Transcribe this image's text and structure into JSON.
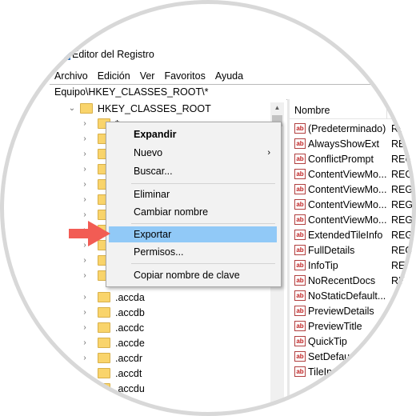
{
  "window": {
    "title": "Editor del Registro"
  },
  "menubar": {
    "items": [
      "Archivo",
      "Edición",
      "Ver",
      "Favoritos",
      "Ayuda"
    ]
  },
  "address": {
    "path": "Equipo\\HKEY_CLASSES_ROOT\\*"
  },
  "tree": {
    "root_label": "HKEY_CLASSES_ROOT",
    "selected_label": "*",
    "items": [
      ".accda",
      ".accdb",
      ".accdc",
      ".accde",
      ".accdr",
      ".accdt",
      ".accdu"
    ]
  },
  "values_pane": {
    "header_name": "Nombre",
    "rows": [
      {
        "name": "(Predeterminado)",
        "type": "RE"
      },
      {
        "name": "AlwaysShowExt",
        "type": "RE"
      },
      {
        "name": "ConflictPrompt",
        "type": "REG"
      },
      {
        "name": "ContentViewMo...",
        "type": "REG"
      },
      {
        "name": "ContentViewMo...",
        "type": "REG"
      },
      {
        "name": "ContentViewMo...",
        "type": "REG"
      },
      {
        "name": "ContentViewMo...",
        "type": "REG"
      },
      {
        "name": "ExtendedTileInfo",
        "type": "REG"
      },
      {
        "name": "FullDetails",
        "type": "REG"
      },
      {
        "name": "InfoTip",
        "type": "REG"
      },
      {
        "name": "NoRecentDocs",
        "type": "RE"
      },
      {
        "name": "NoStaticDefault...",
        "type": ""
      },
      {
        "name": "PreviewDetails",
        "type": ""
      },
      {
        "name": "PreviewTitle",
        "type": ""
      },
      {
        "name": "QuickTip",
        "type": ""
      },
      {
        "name": "SetDefau",
        "type": ""
      },
      {
        "name": "TileIn",
        "type": ""
      }
    ]
  },
  "context_menu": {
    "expand": "Expandir",
    "new": "Nuevo",
    "find": "Buscar...",
    "delete": "Eliminar",
    "rename": "Cambiar nombre",
    "export": "Exportar",
    "permissions": "Permisos...",
    "copy_key_name": "Copiar nombre de clave"
  },
  "icons": {
    "string_value": "ab-icon",
    "folder": "folder-icon",
    "pointer": "red-arrow-icon"
  },
  "colors": {
    "highlight": "#91c9f7",
    "folder": "#f9d46b",
    "arrow": "#f25c54"
  }
}
